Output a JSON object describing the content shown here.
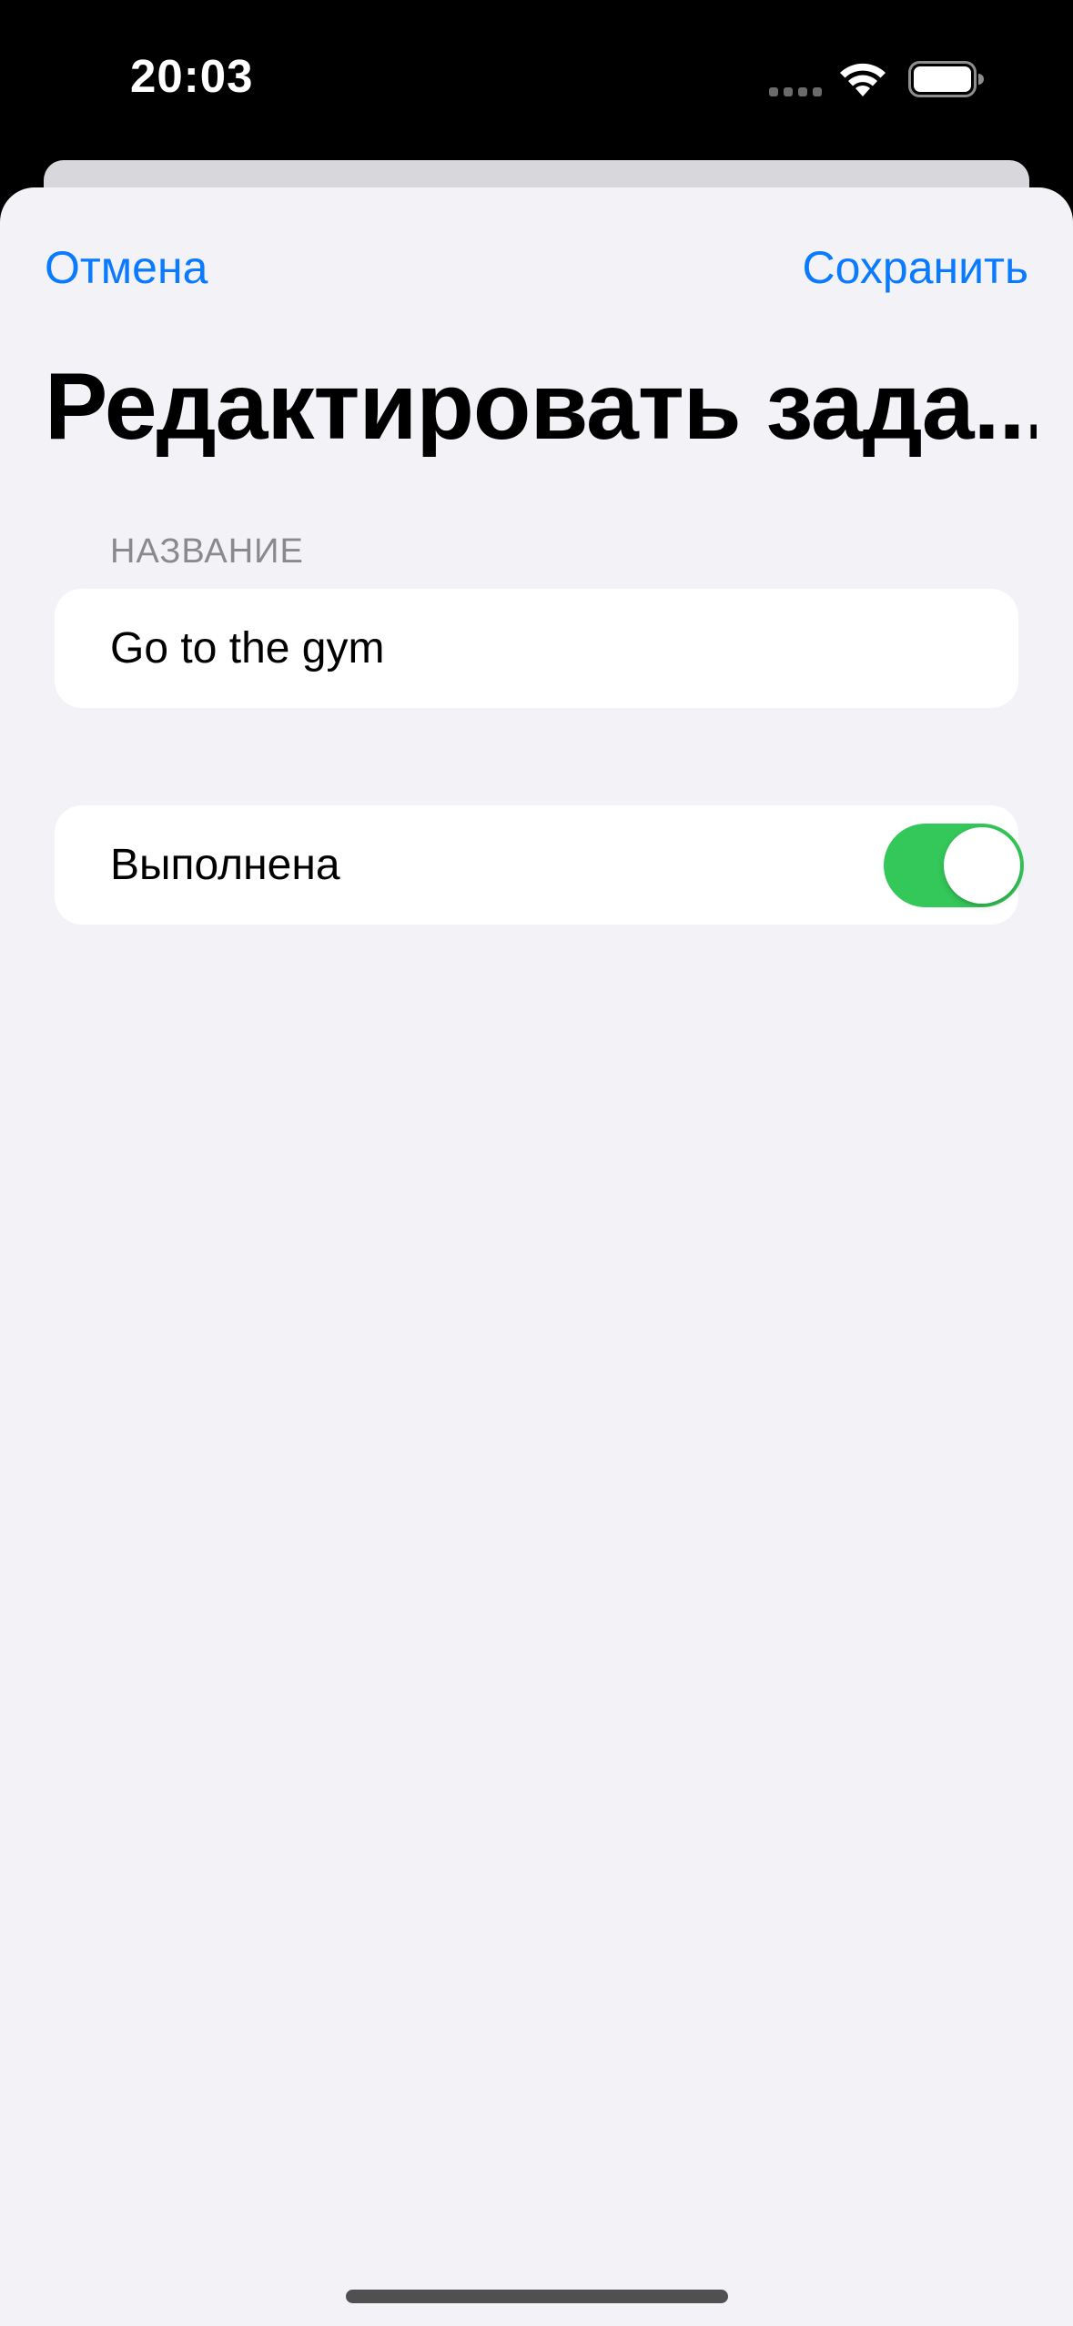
{
  "status_bar": {
    "time": "20:03",
    "icons": [
      "cellular-signal-icon",
      "wifi-icon",
      "battery-icon"
    ]
  },
  "nav": {
    "cancel_label": "Отмена",
    "save_label": "Сохранить"
  },
  "title": "Редактировать зада...",
  "form": {
    "name_section_header": "НАЗВАНИЕ",
    "name_value": "Go to the gym",
    "completed_label": "Выполнена",
    "completed_on": true
  },
  "colors": {
    "accent": "#0a7aff",
    "switch_on": "#34c759",
    "sheet_background": "#f2f2f7"
  }
}
